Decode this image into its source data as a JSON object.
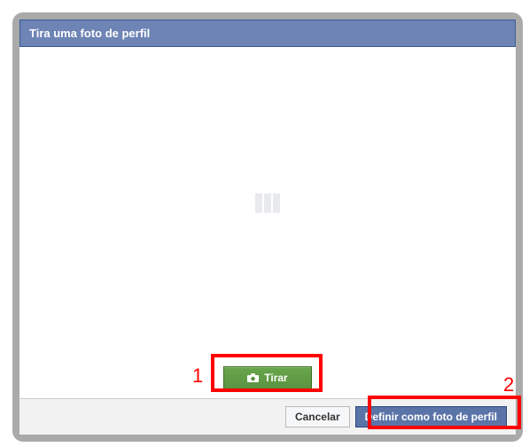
{
  "modal": {
    "title": "Tira uma foto de perfil",
    "capture_label": "Tirar",
    "cancel_label": "Cancelar",
    "confirm_label": "Definir como foto de perfil"
  },
  "annotations": {
    "num1": "1",
    "num2": "2"
  },
  "colors": {
    "header_bg": "#6d84b4",
    "green_btn": "#5b9441",
    "blue_btn": "#5b74a8",
    "annotation": "#ff0000"
  }
}
